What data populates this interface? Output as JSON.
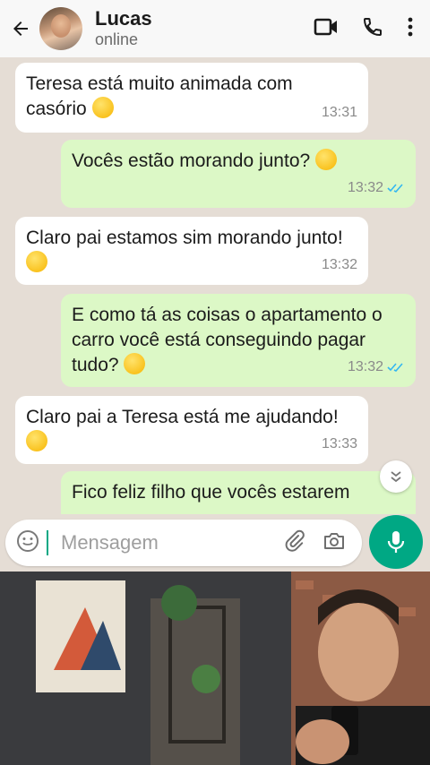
{
  "header": {
    "contact_name": "Lucas",
    "status": "online",
    "icons": [
      "back-arrow-icon",
      "video-call-icon",
      "phone-icon",
      "more-vert-icon"
    ]
  },
  "messages": [
    {
      "direction": "in",
      "text": "Teresa está muito animada com casório",
      "emoji": "grinning-face",
      "time": "13:31"
    },
    {
      "direction": "out",
      "text": "Vocês estão morando junto?",
      "emoji": "face-with-raised-eyebrow",
      "time": "13:32",
      "ticks": "read"
    },
    {
      "direction": "in",
      "text": "Claro pai estamos sim morando junto!",
      "emoji": "slightly-smiling-face",
      "time": "13:32"
    },
    {
      "direction": "out",
      "text": "E como tá as coisas o apartamento o carro você está conseguindo pagar tudo?",
      "emoji": "thinking-face",
      "time": "13:32",
      "ticks": "read"
    },
    {
      "direction": "in",
      "text": "Claro pai a Teresa está me ajudando!",
      "emoji": "smiling-face",
      "time": "13:33"
    },
    {
      "direction": "out",
      "text": "Fico feliz filho que vocês estarem",
      "time": ""
    }
  ],
  "composer": {
    "placeholder": "Mensagem"
  },
  "colors": {
    "outgoing_bubble": "#dcf8c6",
    "incoming_bubble": "#ffffff",
    "accent": "#00a884",
    "chat_background": "#e5ddd5"
  }
}
